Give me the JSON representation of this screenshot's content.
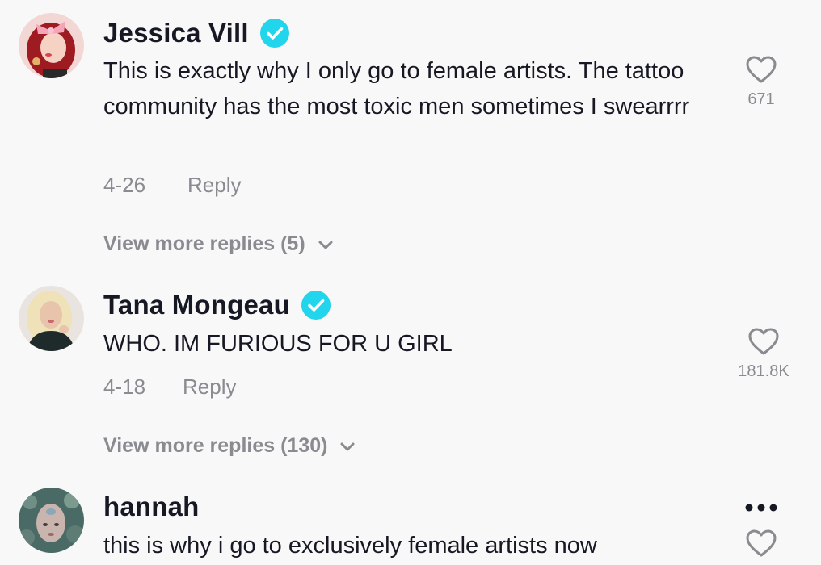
{
  "comments": [
    {
      "username": "Jessica Vill",
      "verified": true,
      "text": "This is exactly why I only go to female artists. The tattoo community has the most toxic men sometimes I swearrrr",
      "date": "4-26",
      "reply_label": "Reply",
      "like_count": "671",
      "view_more": "View more replies (5)"
    },
    {
      "username": "Tana Mongeau",
      "verified": true,
      "text": "WHO. IM FURIOUS FOR U GIRL",
      "date": "4-18",
      "reply_label": "Reply",
      "like_count": "181.8K",
      "view_more": "View more replies (130)"
    },
    {
      "username": "hannah",
      "verified": false,
      "text": "this is why i go to exclusively female artists now"
    }
  ],
  "colors": {
    "verified_badge": "#20d5ec",
    "secondary_text": "#8a8b91",
    "primary_text": "#161823",
    "background": "#f8f8f8"
  },
  "icons": {
    "like": "heart-outline-icon",
    "verified": "verified-check-icon",
    "expand": "chevron-down-icon",
    "more": "ellipsis-icon"
  }
}
